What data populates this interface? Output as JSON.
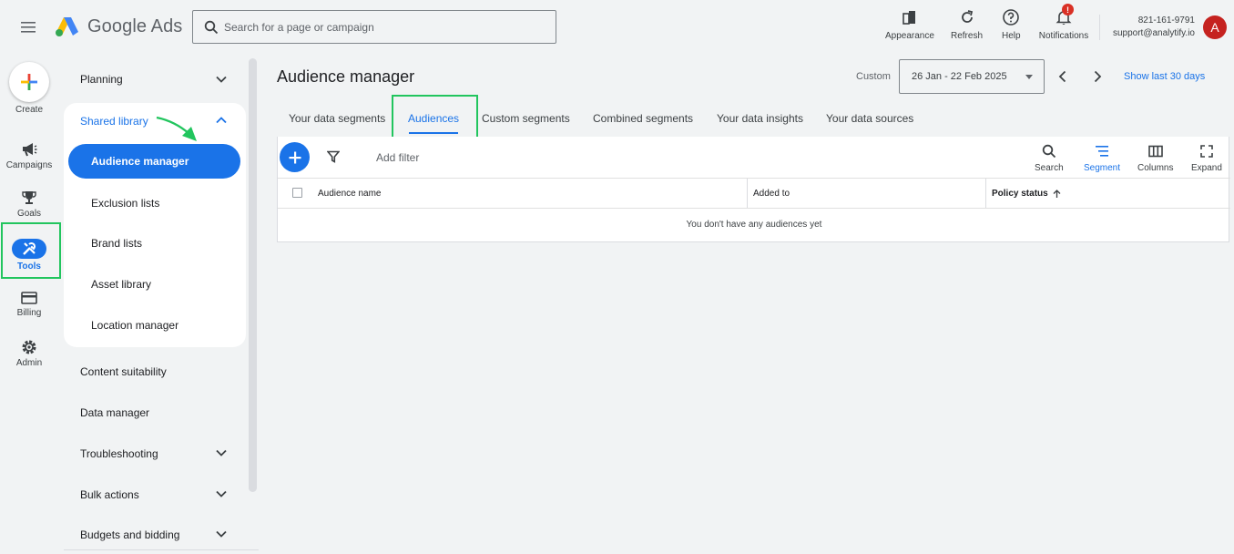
{
  "header": {
    "product_name": "Google Ads",
    "search_placeholder": "Search for a page or campaign",
    "tools": [
      {
        "label": "Appearance",
        "icon": "appearance-icon"
      },
      {
        "label": "Refresh",
        "icon": "refresh-icon"
      },
      {
        "label": "Help",
        "icon": "help-icon"
      },
      {
        "label": "Notifications",
        "icon": "bell-icon",
        "badge": "!"
      }
    ],
    "account_id": "821-161-9791",
    "account_email": "support@analytify.io",
    "avatar_letter": "A"
  },
  "rail": {
    "create": "Create",
    "campaigns": "Campaigns",
    "goals": "Goals",
    "tools": "Tools",
    "billing": "Billing",
    "admin": "Admin"
  },
  "nav": {
    "planning": "Planning",
    "shared_library": "Shared library",
    "sub_items": [
      "Audience manager",
      "Exclusion lists",
      "Brand lists",
      "Asset library",
      "Location manager"
    ],
    "content_suitability": "Content suitability",
    "data_manager": "Data manager",
    "troubleshooting": "Troubleshooting",
    "bulk_actions": "Bulk actions",
    "budgets_bidding": "Budgets and bidding"
  },
  "main": {
    "title": "Audience manager",
    "date_label": "Custom",
    "date_range": "26 Jan - 22 Feb 2025",
    "show_last": "Show last 30 days",
    "tabs": [
      "Your data segments",
      "Audiences",
      "Custom segments",
      "Combined segments",
      "Your data insights",
      "Your data sources"
    ],
    "active_tab": "Audiences",
    "add_filter": "Add filter",
    "toolbar": [
      "Search",
      "Segment",
      "Columns",
      "Expand"
    ],
    "columns": [
      "Audience name",
      "Added to",
      "Policy status"
    ],
    "empty_message": "You don't have any audiences yet"
  },
  "colors": {
    "accent": "#1a73e8",
    "highlight_box": "#22c55e",
    "badge": "#d93025",
    "avatar": "#c5221f"
  }
}
